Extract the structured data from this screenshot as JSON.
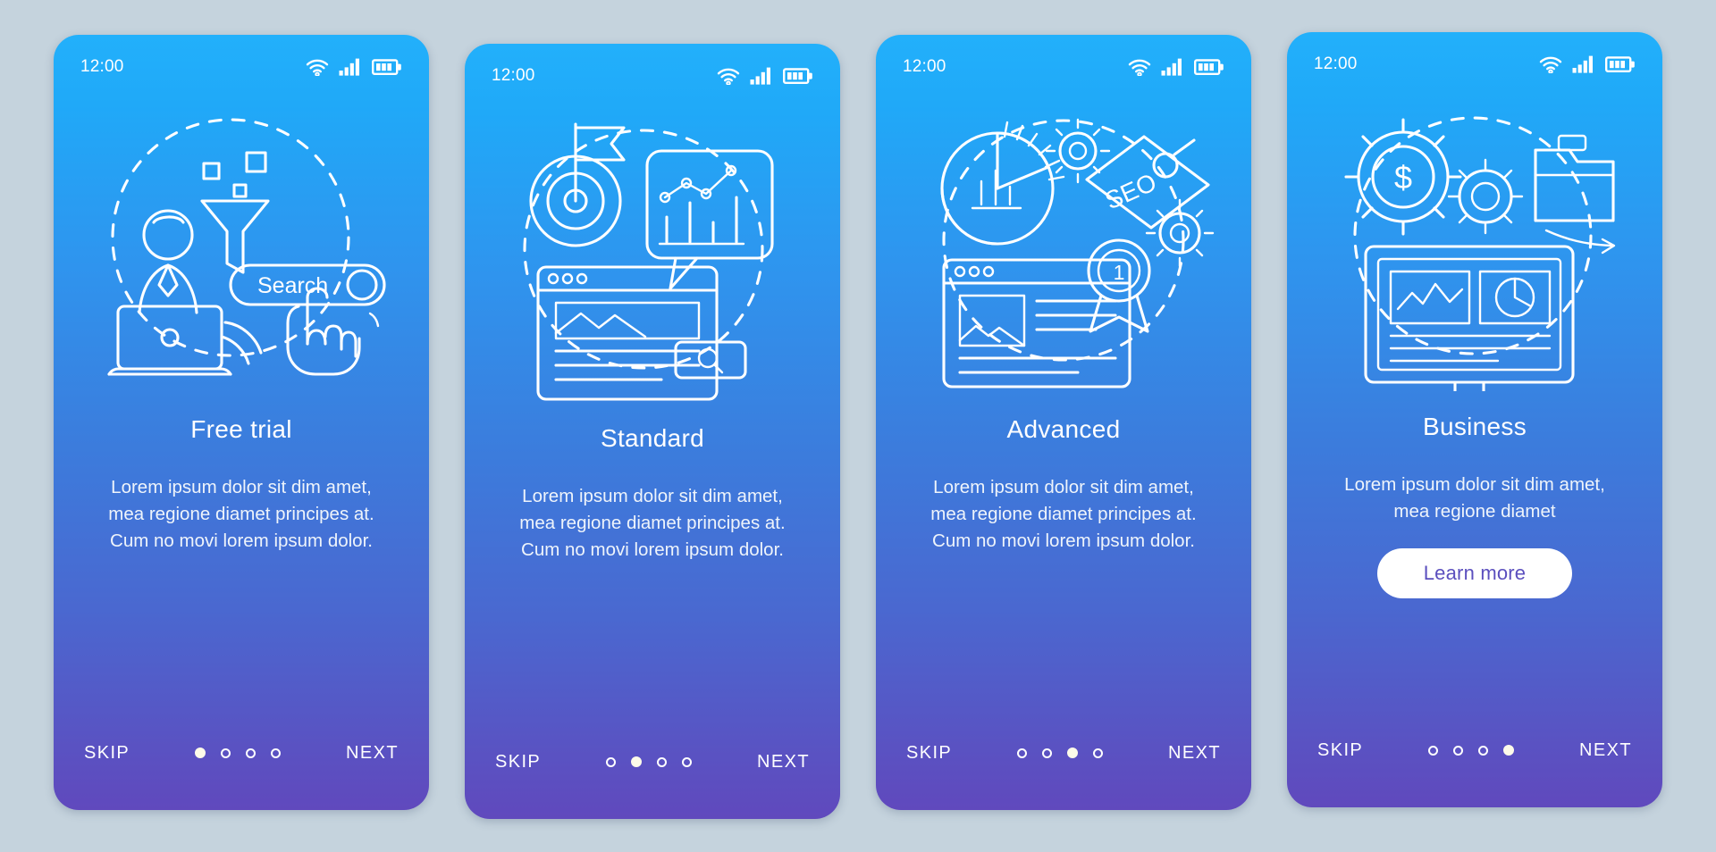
{
  "meta": {
    "background_color": "#c5d3dd",
    "screen_gradient_top": "#22b0fb",
    "screen_gradient_mid": "#3b7ddd",
    "screen_gradient_bottom": "#6049bd",
    "cta_text_color": "#5b4fbe",
    "active_dot_color": "#fdfbe9"
  },
  "screens": [
    {
      "id": "free-trial",
      "status": {
        "time": "12:00",
        "icons": [
          "wifi-icon",
          "cellular-signal-icon",
          "battery-icon"
        ]
      },
      "illustration": {
        "name": "search-funnel-illustration",
        "label": "Search",
        "elements": [
          "dashed-circle",
          "funnel",
          "person-at-laptop",
          "search-bar",
          "magnifier",
          "pointing-hand",
          "squares"
        ]
      },
      "title": "Free trial",
      "body": "Lorem ipsum dolor sit dim amet, mea regione diamet principes at. Cum no movi lorem ipsum dolor.",
      "cta": null,
      "footer": {
        "skip_label": "SKIP",
        "next_label": "NEXT",
        "dots_total": 4,
        "dot_active_index": 0
      }
    },
    {
      "id": "standard",
      "status": {
        "time": "12:00",
        "icons": [
          "wifi-icon",
          "cellular-signal-icon",
          "battery-icon"
        ]
      },
      "illustration": {
        "name": "target-chart-browser-illustration",
        "label": "",
        "elements": [
          "dashed-circle",
          "target-with-flag",
          "speech-bubble-bar-chart",
          "browser-window",
          "search-magnifier-button"
        ]
      },
      "title": "Standard",
      "body": "Lorem ipsum dolor sit dim amet, mea regione diamet principes at. Cum no movi lorem ipsum dolor.",
      "cta": null,
      "footer": {
        "skip_label": "SKIP",
        "next_label": "NEXT",
        "dots_total": 4,
        "dot_active_index": 1
      }
    },
    {
      "id": "advanced",
      "status": {
        "time": "12:00",
        "icons": [
          "wifi-icon",
          "cellular-signal-icon",
          "battery-icon"
        ]
      },
      "illustration": {
        "name": "seo-analytics-illustration",
        "label": "SEO",
        "elements": [
          "dashed-circle",
          "donut-chart-with-bars",
          "seo-price-tag",
          "gears",
          "browser-window",
          "award-ribbon-badge"
        ],
        "badge_number": "1"
      },
      "title": "Advanced",
      "body": "Lorem ipsum dolor sit dim amet, mea regione diamet principes at. Cum no movi lorem ipsum dolor.",
      "cta": null,
      "footer": {
        "skip_label": "SKIP",
        "next_label": "NEXT",
        "dots_total": 4,
        "dot_active_index": 2
      }
    },
    {
      "id": "business",
      "status": {
        "time": "12:00",
        "icons": [
          "wifi-icon",
          "cellular-signal-icon",
          "battery-icon"
        ]
      },
      "illustration": {
        "name": "business-dashboard-illustration",
        "label": "$",
        "elements": [
          "dashed-circle",
          "gear-with-dollar",
          "small-gear",
          "briefcase",
          "arrow",
          "desktop-monitor-dashboard",
          "line-chart-panel",
          "pie-chart-panel"
        ]
      },
      "title": "Business",
      "body": "Lorem ipsum dolor sit dim amet, mea regione diamet",
      "cta": "Learn more",
      "footer": {
        "skip_label": "SKIP",
        "next_label": "NEXT",
        "dots_total": 4,
        "dot_active_index": 3
      }
    }
  ]
}
